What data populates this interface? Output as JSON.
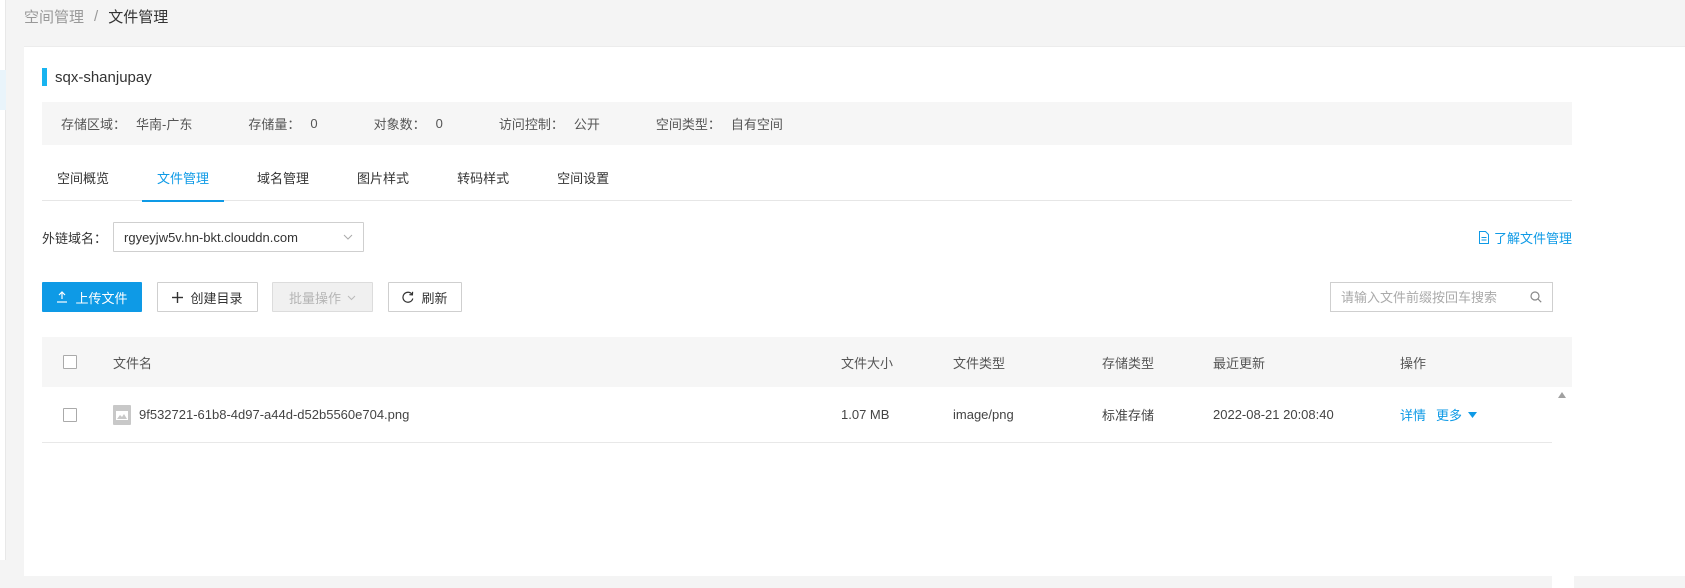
{
  "breadcrumb": {
    "parent": "空间管理",
    "separator": "/",
    "current": "文件管理"
  },
  "bucket": {
    "name": "sqx-shanjupay"
  },
  "info": [
    {
      "key": "存储区域：",
      "value": "华南-广东"
    },
    {
      "key": "存储量：",
      "value": "0"
    },
    {
      "key": "对象数：",
      "value": "0"
    },
    {
      "key": "访问控制：",
      "value": "公开"
    },
    {
      "key": "空间类型：",
      "value": "自有空间"
    }
  ],
  "tabs": [
    {
      "label": "空间概览",
      "active": false
    },
    {
      "label": "文件管理",
      "active": true
    },
    {
      "label": "域名管理",
      "active": false
    },
    {
      "label": "图片样式",
      "active": false
    },
    {
      "label": "转码样式",
      "active": false
    },
    {
      "label": "空间设置",
      "active": false
    }
  ],
  "domain": {
    "label": "外链域名：",
    "selected": "rgyeyjw5v.hn-bkt.clouddn.com",
    "learn_link": "了解文件管理"
  },
  "toolbar": {
    "upload_label": "上传文件",
    "create_dir_label": "创建目录",
    "batch_label": "批量操作",
    "refresh_label": "刷新",
    "search_placeholder": "请输入文件前缀按回车搜索"
  },
  "table": {
    "headers": {
      "name": "文件名",
      "size": "文件大小",
      "type": "文件类型",
      "storage": "存储类型",
      "updated": "最近更新",
      "ops": "操作"
    },
    "rows": [
      {
        "name": "9f532721-61b8-4d97-a44d-d52b5560e704.png",
        "size": "1.07 MB",
        "type": "image/png",
        "storage": "标准存储",
        "updated": "2022-08-21 20:08:40",
        "detail": "详情",
        "more": "更多"
      }
    ]
  },
  "colors": {
    "accent": "#0e9ae6",
    "bucket_bar": "#18b4f0"
  }
}
